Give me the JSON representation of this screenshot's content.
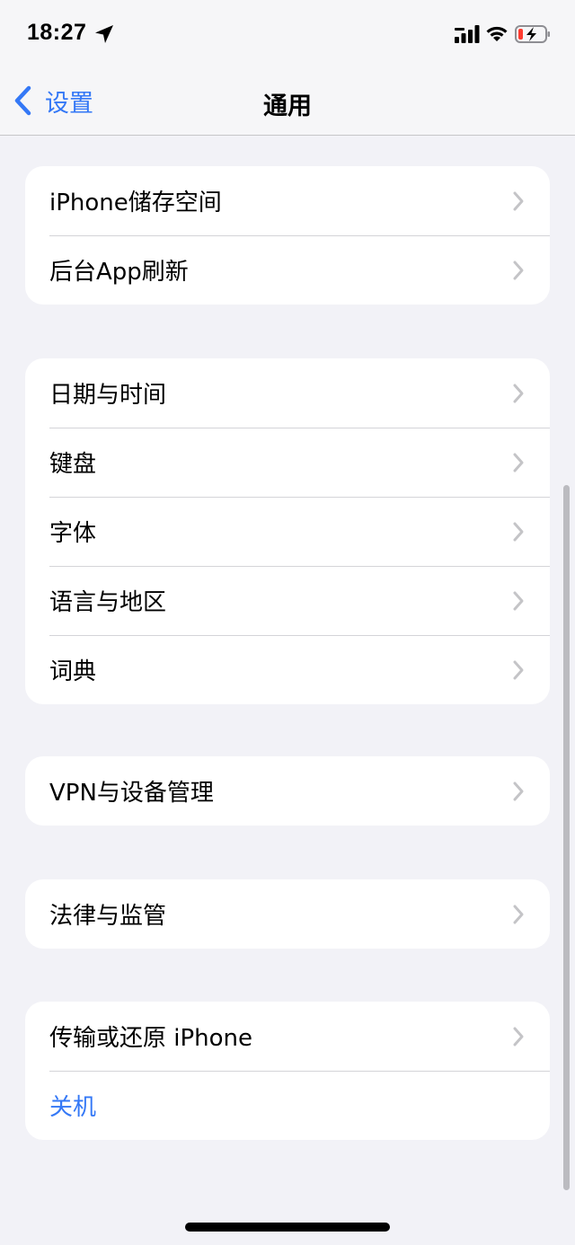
{
  "status_bar": {
    "time": "18:27",
    "icons": [
      "location-arrow-icon",
      "cellular-signal-icon",
      "wifi-icon",
      "battery-charging-icon"
    ]
  },
  "nav": {
    "back_label": "设置",
    "title": "通用"
  },
  "groups": [
    {
      "items": [
        {
          "label": "iPhone储存空间"
        },
        {
          "label": "后台App刷新"
        }
      ]
    },
    {
      "items": [
        {
          "label": "日期与时间"
        },
        {
          "label": "键盘"
        },
        {
          "label": "字体"
        },
        {
          "label": "语言与地区"
        },
        {
          "label": "词典"
        }
      ]
    },
    {
      "items": [
        {
          "label": "VPN与设备管理"
        }
      ]
    },
    {
      "items": [
        {
          "label": "法律与监管"
        }
      ]
    },
    {
      "items": [
        {
          "label": "传输或还原 iPhone"
        },
        {
          "label": "关机"
        }
      ]
    }
  ],
  "colors": {
    "accent": "#3478f6",
    "background": "#f2f2f7",
    "cell": "#ffffff",
    "chevron": "#c4c4c7",
    "battery_low": "#ff3b30"
  }
}
